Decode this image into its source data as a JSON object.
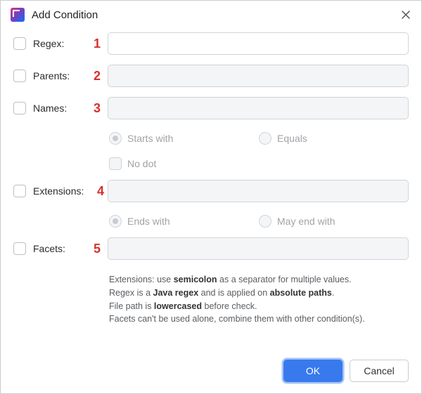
{
  "title": "Add Condition",
  "steps": {
    "s1": "1",
    "s2": "2",
    "s3": "3",
    "s4": "4",
    "s5": "5"
  },
  "fields": {
    "regex": {
      "label": "Regex:",
      "value": ""
    },
    "parents": {
      "label": "Parents:",
      "value": ""
    },
    "names": {
      "label": "Names:",
      "value": ""
    },
    "extensions": {
      "label": "Extensions:",
      "value": ""
    },
    "facets": {
      "label": "Facets:",
      "value": ""
    }
  },
  "name_opts": {
    "starts_with": "Starts with",
    "equals": "Equals",
    "no_dot": "No dot"
  },
  "ext_opts": {
    "ends_with": "Ends with",
    "may_end_with": "May end with"
  },
  "help": {
    "l1a": "Extensions: use ",
    "l1b": "semicolon",
    "l1c": " as a separator for multiple values.",
    "l2a": "Regex is a ",
    "l2b": "Java regex",
    "l2c": " and is applied on ",
    "l2d": "absolute paths",
    "l2e": ".",
    "l3a": "File path is ",
    "l3b": "lowercased",
    "l3c": " before check.",
    "l4": "Facets can't be used alone, combine them with other condition(s)."
  },
  "buttons": {
    "ok": "OK",
    "cancel": "Cancel"
  }
}
